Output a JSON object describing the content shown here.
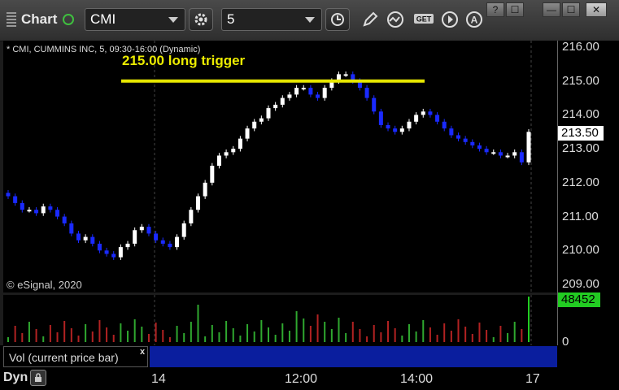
{
  "toolbar": {
    "title": "Chart",
    "symbol": "CMI",
    "interval": "5"
  },
  "window_buttons": [
    "?",
    "☐",
    "—",
    "☐",
    "✕"
  ],
  "chart": {
    "header": "* CMI, CUMMINS INC, 5, 09:30-16:00 (Dynamic)",
    "annotation": "215.00 long trigger",
    "watermark": "© eSignal, 2020",
    "price_labels": [
      "216.00",
      "215.00",
      "214.00",
      "213.00",
      "212.00",
      "211.00",
      "210.00",
      "209.00"
    ],
    "last_price": "213.50",
    "volume_last": "48452",
    "volume_zero": "0",
    "study_label": "Vol (current price bar)",
    "study_close": "x",
    "footer_label": "Dyn",
    "x_labels": [
      "14",
      "12:00",
      "14:00",
      "17"
    ],
    "colors": {
      "up": "#ffffff",
      "down": "#1a2aff",
      "trigger": "#e6e600",
      "vol_up": "#2fa82f",
      "vol_down": "#b22222",
      "last_volume": "#22cc22"
    }
  },
  "chart_data": {
    "type": "candlestick",
    "title": "* CMI, CUMMINS INC, 5, 09:30-16:00 (Dynamic)",
    "ylim": [
      209.0,
      216.0
    ],
    "x_ticks": [
      "14",
      "12:00",
      "14:00",
      "17"
    ],
    "annotation": {
      "text": "215.00 long trigger",
      "price": 215.0
    },
    "closes": [
      211.6,
      211.4,
      211.2,
      211.2,
      211.1,
      211.3,
      211.2,
      211.0,
      210.8,
      210.5,
      210.3,
      210.4,
      210.2,
      210.0,
      209.9,
      209.8,
      210.1,
      210.2,
      210.6,
      210.7,
      210.5,
      210.3,
      210.2,
      210.1,
      210.4,
      210.8,
      211.2,
      211.6,
      212.0,
      212.5,
      212.8,
      212.9,
      213.0,
      213.3,
      213.6,
      213.8,
      213.9,
      214.2,
      214.3,
      214.5,
      214.6,
      214.8,
      214.8,
      214.6,
      214.5,
      214.8,
      215.0,
      215.2,
      215.2,
      215.0,
      214.8,
      214.5,
      214.1,
      213.7,
      213.6,
      213.5,
      213.6,
      213.8,
      214.0,
      214.1,
      214.0,
      213.8,
      213.6,
      213.4,
      213.3,
      213.2,
      213.1,
      213.0,
      212.9,
      212.9,
      212.8,
      212.8,
      212.9,
      212.6,
      213.5
    ],
    "volume_last": 48452
  }
}
